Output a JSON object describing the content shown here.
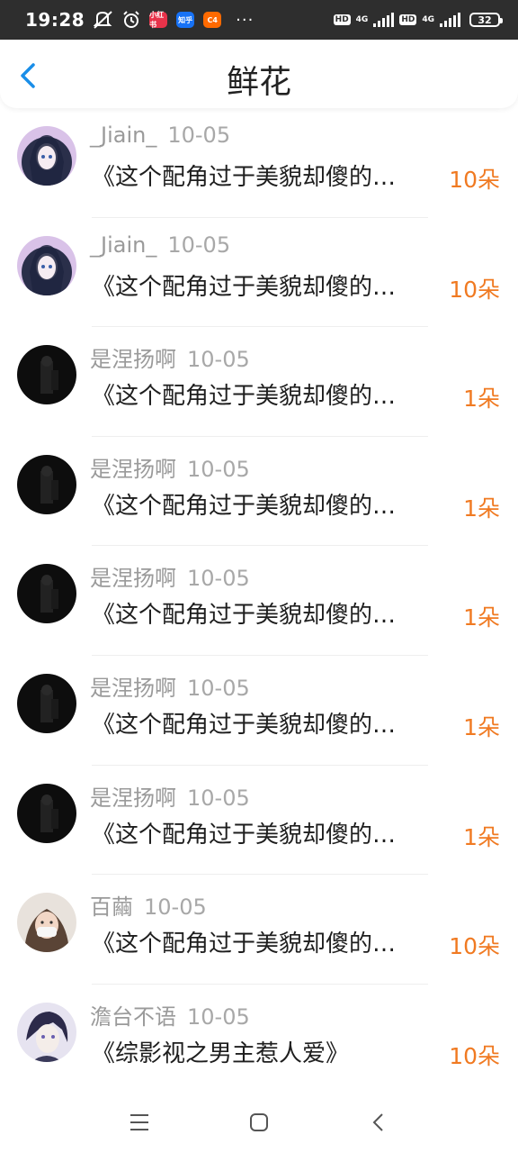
{
  "status_bar": {
    "time": "19:28",
    "app_badges": [
      {
        "label": "小红书",
        "color": "#e8334a"
      },
      {
        "label": "知乎",
        "color": "#1772f6"
      },
      {
        "label": "C4",
        "color": "#ff6a00"
      }
    ],
    "more": "···",
    "hd1": "HD",
    "net1": "4G",
    "hd2": "HD",
    "net2": "4G",
    "battery": "32"
  },
  "header": {
    "title": "鲜花"
  },
  "colors": {
    "accent": "#1a8ee8",
    "amount": "#f07a22"
  },
  "items": [
    {
      "name": "_Jiain_",
      "date": "10-05",
      "title": "《这个配角过于美貌却傻的…",
      "amount": "10朵",
      "avatar": "anime-girl-purple"
    },
    {
      "name": "_Jiain_",
      "date": "10-05",
      "title": "《这个配角过于美貌却傻的…",
      "amount": "10朵",
      "avatar": "anime-girl-purple"
    },
    {
      "name": "是涅扬啊",
      "date": "10-05",
      "title": "《这个配角过于美貌却傻的…",
      "amount": "1朵",
      "avatar": "dark-figure"
    },
    {
      "name": "是涅扬啊",
      "date": "10-05",
      "title": "《这个配角过于美貌却傻的…",
      "amount": "1朵",
      "avatar": "dark-figure"
    },
    {
      "name": "是涅扬啊",
      "date": "10-05",
      "title": "《这个配角过于美貌却傻的…",
      "amount": "1朵",
      "avatar": "dark-figure"
    },
    {
      "name": "是涅扬啊",
      "date": "10-05",
      "title": "《这个配角过于美貌却傻的…",
      "amount": "1朵",
      "avatar": "dark-figure"
    },
    {
      "name": "是涅扬啊",
      "date": "10-05",
      "title": "《这个配角过于美貌却傻的…",
      "amount": "1朵",
      "avatar": "dark-figure"
    },
    {
      "name": "百繭",
      "date": "10-05",
      "title": "《这个配角过于美貌却傻的…",
      "amount": "10朵",
      "avatar": "girl-photo"
    },
    {
      "name": "澹台不语",
      "date": "10-05",
      "title": "《综影视之男主惹人爱》",
      "amount": "10朵",
      "avatar": "anime-boy"
    }
  ],
  "nav_icons": [
    "menu-icon",
    "home-icon",
    "back-icon"
  ]
}
